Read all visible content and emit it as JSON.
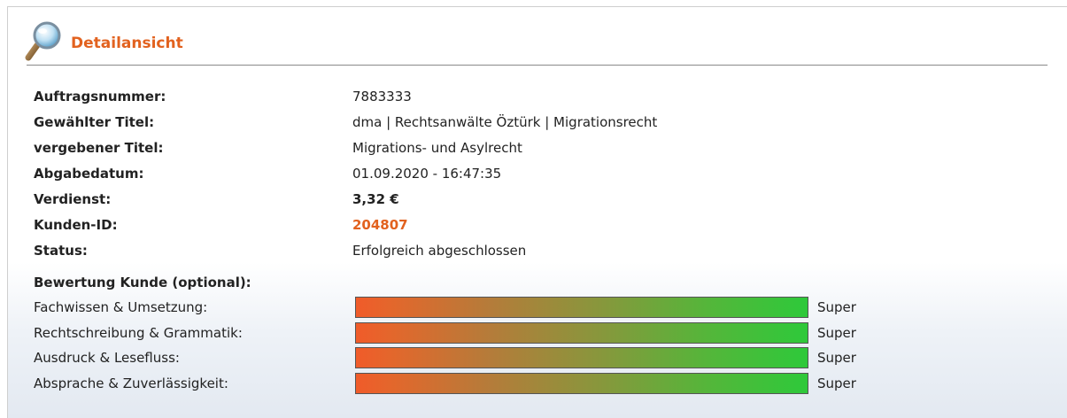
{
  "header": {
    "title": "Detailansicht",
    "icon": "magnifier-icon"
  },
  "details": [
    {
      "key": "auftragsnummer",
      "label": "Auftragsnummer:",
      "value": "7883333",
      "style": ""
    },
    {
      "key": "gewaehlter-titel",
      "label": "Gewählter Titel:",
      "value": "dma | Rechtsanwälte Öztürk | Migrationsrecht",
      "style": ""
    },
    {
      "key": "vergebener-titel",
      "label": "vergebener Titel:",
      "value": "Migrations- und Asylrecht",
      "style": ""
    },
    {
      "key": "abgabedatum",
      "label": "Abgabedatum:",
      "value": "01.09.2020 - 16:47:35",
      "style": ""
    },
    {
      "key": "verdienst",
      "label": "Verdienst:",
      "value": "3,32 €",
      "style": "bold"
    },
    {
      "key": "kunden-id",
      "label": "Kunden-ID:",
      "value": "204807",
      "style": "accent"
    },
    {
      "key": "status",
      "label": "Status:",
      "value": "Erfolgreich abgeschlossen",
      "style": ""
    }
  ],
  "rating": {
    "title": "Bewertung Kunde (optional):",
    "items": [
      {
        "key": "fachwissen",
        "label": "Fachwissen & Umsetzung:",
        "level": 1.0,
        "text": "Super"
      },
      {
        "key": "rechtschreibung",
        "label": "Rechtschreibung & Grammatik:",
        "level": 1.0,
        "text": "Super"
      },
      {
        "key": "ausdruck",
        "label": "Ausdruck & Lesefluss:",
        "level": 1.0,
        "text": "Super"
      },
      {
        "key": "absprache",
        "label": "Absprache & Zuverlässigkeit:",
        "level": 1.0,
        "text": "Super"
      }
    ]
  },
  "colors": {
    "accent": "#e2621f",
    "bar_start": "#f05b2a",
    "bar_end": "#2ec93a"
  }
}
